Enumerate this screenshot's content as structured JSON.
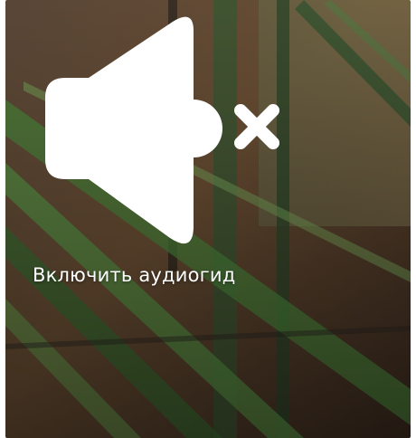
{
  "audio_guide": {
    "label": "Включить аудиогид",
    "state": "muted",
    "icon": "speaker-muted-icon"
  },
  "colors": {
    "icon": "#ffffff",
    "label": "#ffffff",
    "plant_green": "#4f8a3e",
    "wall_brown": "#6a4c33"
  }
}
